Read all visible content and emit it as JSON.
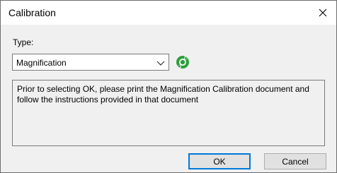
{
  "window": {
    "title": "Calibration",
    "close_icon": "close-icon"
  },
  "form": {
    "type_label": "Type:",
    "type_value": "Magnification",
    "dropdown_icon": "chevron-down-icon",
    "refresh_icon": "refresh-icon",
    "refresh_color": "#2e9e3c"
  },
  "info": {
    "text": "Prior to selecting OK, please print the Magnification Calibration document and follow the instructions provided in that document"
  },
  "buttons": {
    "ok_label": "OK",
    "cancel_label": "Cancel"
  },
  "colors": {
    "accent": "#0078d7",
    "background": "#f0f0f0"
  }
}
